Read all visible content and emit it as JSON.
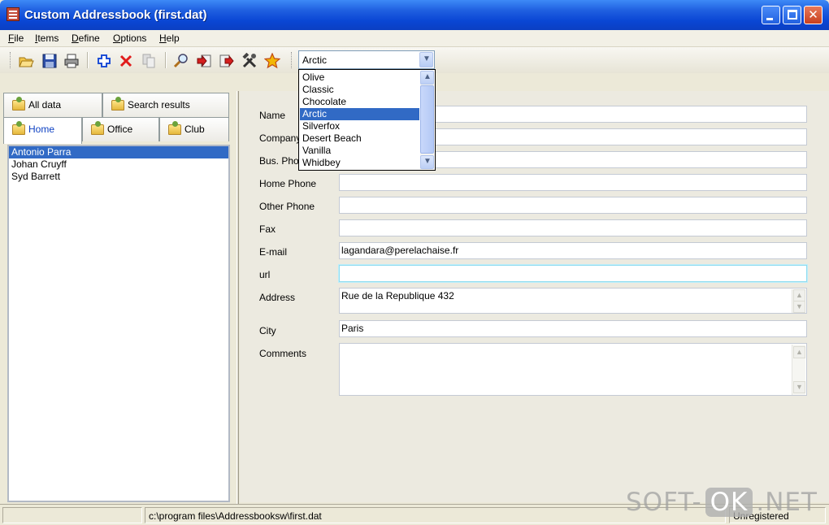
{
  "window": {
    "title": "Custom Addressbook (first.dat)"
  },
  "menu": {
    "items": [
      "File",
      "Items",
      "Define",
      "Options",
      "Help"
    ]
  },
  "toolbar": {
    "icons": [
      "open-folder-icon",
      "save-icon",
      "print-icon",
      "add-icon",
      "delete-icon",
      "copy-icon",
      "search-icon",
      "import-icon",
      "export-icon",
      "tools-icon",
      "favorite-star-icon"
    ],
    "colors": {
      "add": "#1f4fd6",
      "delete": "#e01b1b",
      "star": "#f2b705"
    }
  },
  "theme": {
    "selected": "Arctic",
    "options": [
      "Olive",
      "Classic",
      "Chocolate",
      "Arctic",
      "Silverfox",
      "Desert Beach",
      "Vanilla",
      "Whidbey"
    ]
  },
  "tabs": {
    "row1": [
      "All data",
      "Search results"
    ],
    "row2": [
      "Home",
      "Office",
      "Club"
    ],
    "active": "Home"
  },
  "contacts": [
    "Antonio Parra",
    "Johan Cruyff",
    "Syd Barrett"
  ],
  "selected_contact": "Antonio Parra",
  "form": {
    "labels": {
      "name": "Name",
      "company": "Company",
      "bus_phone": "Bus. Phone",
      "home_phone": "Home Phone",
      "other_phone": "Other Phone",
      "fax": "Fax",
      "email": "E-mail",
      "url": "url",
      "address": "Address",
      "city": "City",
      "comments": "Comments"
    },
    "values": {
      "name": "",
      "company": "",
      "bus_phone": "",
      "home_phone": "",
      "other_phone": "",
      "fax": "",
      "email": "lagandara@perelachaise.fr",
      "url": "",
      "address": "Rue de la Republique 432",
      "city": "Paris",
      "comments": ""
    }
  },
  "status": {
    "path": "c:\\program files\\Addressbooksw\\first.dat",
    "registration": "Unregistered"
  },
  "watermark": {
    "left": "SOFT-",
    "mid": "OK",
    "right": ".NET"
  }
}
